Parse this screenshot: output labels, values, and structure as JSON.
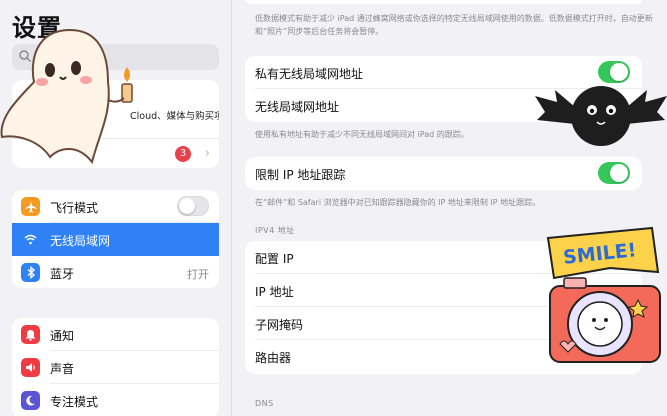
{
  "sidebar": {
    "title": "设置",
    "profile_subtitle": "Cloud、媒体与购买项目",
    "badge_count": "3",
    "network_items": [
      {
        "label": "飞行模式",
        "value": "",
        "icon": "airplane-icon",
        "color": "#f59b23"
      },
      {
        "label": "无线局域网",
        "value": "",
        "icon": "wifi-icon",
        "color": "#2f82f6"
      },
      {
        "label": "蓝牙",
        "value": "打开",
        "icon": "bluetooth-icon",
        "color": "#2f82f6"
      }
    ],
    "notify_items": [
      {
        "label": "通知",
        "icon": "bell-icon",
        "color": "#ee3b44"
      },
      {
        "label": "声音",
        "icon": "speaker-icon",
        "color": "#ee3b44"
      },
      {
        "label": "专注模式",
        "icon": "moon-icon",
        "color": "#5a55d6"
      }
    ]
  },
  "main": {
    "top_note": "低数据模式有助于减少 iPad 通过蜂窝网络或你选择的特定无线局域网使用的数据。低数据模式打开时，自动更新和“照片”同步等后台任务将会暂停。",
    "private_address_label": "私有无线局域网地址",
    "wifi_address_label": "无线局域网地址",
    "private_note": "使用私有地址有助于减少不同无线局域网间对 iPad 的跟踪。",
    "limit_ip_label": "限制 IP 地址跟踪",
    "limit_ip_note": "在“邮件”和 Safari 浏览器中对已知跟踪器隐藏你的 IP 地址来限制 IP 地址跟踪。",
    "ipv4_header": "IPV4 地址",
    "ipv4_rows": [
      "配置 IP",
      "IP 地址",
      "子网掩码",
      "路由器"
    ],
    "dns_header": "DNS"
  },
  "stickers": {
    "smile_text": "SMILE!"
  },
  "colors": {
    "selection": "#2f82f6",
    "toggle_on": "#35c759",
    "badge": "#e8414b"
  }
}
